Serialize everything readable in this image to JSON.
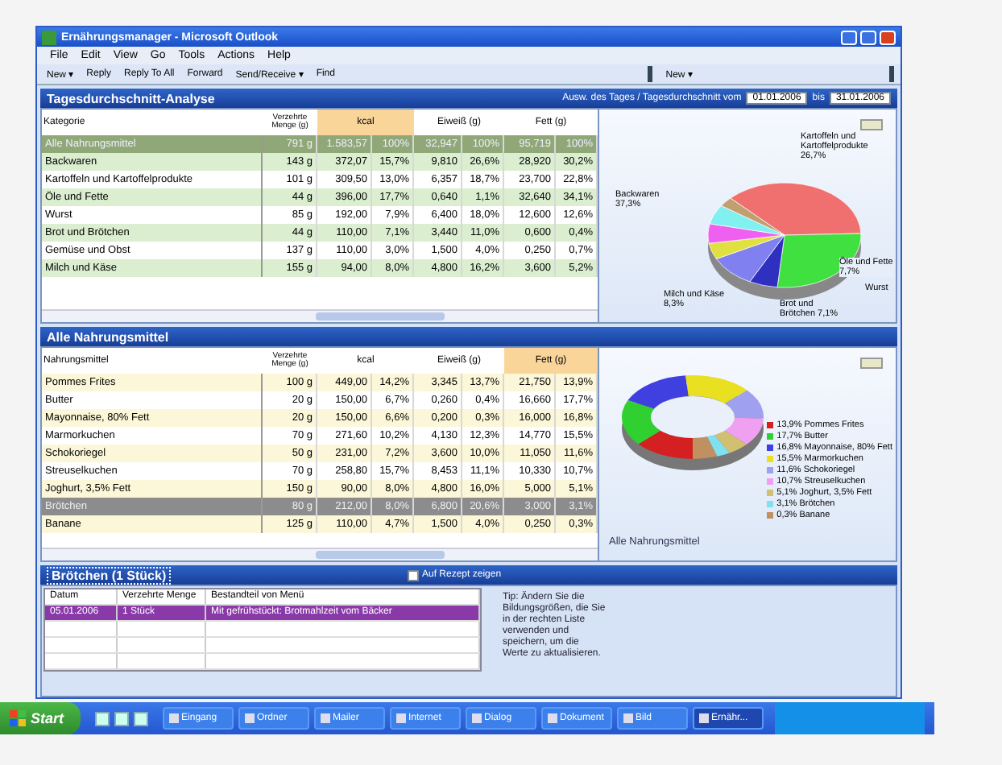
{
  "window": {
    "title": "Ernährungsmanager - Microsoft Outlook"
  },
  "menu": [
    "File",
    "Edit",
    "View",
    "Go",
    "Tools",
    "Actions",
    "Help"
  ],
  "toolbar": {
    "left": [
      "New ▾",
      "Reply",
      "Reply To All",
      "Forward",
      "Send/Receive ▾",
      "Find"
    ],
    "right": [
      "New ▾"
    ]
  },
  "daily": {
    "title": "Tagesdurchschnitt-Analyse",
    "range_label": "Ausw. des Tages / Tagesdurchschnitt vom",
    "from": "01.01.2006",
    "to_label": "bis",
    "to": "31.01.2006",
    "columns": [
      {
        "label": "Kategorie",
        "sorted": false
      },
      {
        "label": "Verzehrte Menge (g)",
        "sorted": false
      },
      {
        "label": "kcal",
        "sorted": true
      },
      {
        "label": "Eiweiß (g)",
        "sorted": false
      },
      {
        "label": "Fett (g)",
        "sorted": false
      }
    ],
    "rows": [
      {
        "kind": "group",
        "cells": [
          "Alle Nahrungsmittel",
          "791 g",
          {
            "value": "1.583,57",
            "share": "100%"
          },
          {
            "value": "32,947",
            "share": "100%"
          },
          {
            "value": "95,719",
            "share": "100%"
          }
        ]
      },
      {
        "kind": "item",
        "cells": [
          "Backwaren",
          "143 g",
          {
            "value": "372,07",
            "share": "15,7%"
          },
          {
            "value": "9,810",
            "share": "26,6%"
          },
          {
            "value": "28,920",
            "share": "30,2%"
          }
        ]
      },
      {
        "kind": "item",
        "cells": [
          "Kartoffeln und Kartoffelprodukte",
          "101 g",
          {
            "value": "309,50",
            "share": "13,0%"
          },
          {
            "value": "6,357",
            "share": "18,7%"
          },
          {
            "value": "23,700",
            "share": "22,8%"
          }
        ]
      },
      {
        "kind": "item",
        "cells": [
          "Öle und Fette",
          "44 g",
          {
            "value": "396,00",
            "share": "17,7%"
          },
          {
            "value": "0,640",
            "share": "1,1%"
          },
          {
            "value": "32,640",
            "share": "34,1%"
          }
        ]
      },
      {
        "kind": "item",
        "cells": [
          "Wurst",
          "85 g",
          {
            "value": "192,00",
            "share": "7,9%"
          },
          {
            "value": "6,400",
            "share": "18,0%"
          },
          {
            "value": "12,600",
            "share": "12,6%"
          }
        ]
      },
      {
        "kind": "item",
        "cells": [
          "Brot und Brötchen",
          "44 g",
          {
            "value": "110,00",
            "share": "7,1%"
          },
          {
            "value": "3,440",
            "share": "11,0%"
          },
          {
            "value": "0,600",
            "share": "0,4%"
          }
        ]
      },
      {
        "kind": "item",
        "cells": [
          "Gemüse und Obst",
          "137 g",
          {
            "value": "110,00",
            "share": "3,0%"
          },
          {
            "value": "1,500",
            "share": "4,0%"
          },
          {
            "value": "0,250",
            "share": "0,7%"
          }
        ]
      },
      {
        "kind": "item",
        "cells": [
          "Milch und Käse",
          "155 g",
          {
            "value": "94,00",
            "share": "8,0%"
          },
          {
            "value": "4,800",
            "share": "16,2%"
          },
          {
            "value": "3,600",
            "share": "5,2%"
          }
        ]
      }
    ],
    "pie_labels": [
      {
        "text": "Kartoffeln und Kartoffelprodukte 26,7%",
        "kind": "top"
      },
      {
        "text": "Backwaren 37,3%",
        "kind": "left"
      },
      {
        "text": "Öle und Fette 7,7%",
        "kind": "right"
      },
      {
        "text": "Milch und Käse 8,3%",
        "kind": "bottomleft"
      },
      {
        "text": "Brot und Brötchen 7,1%",
        "kind": "bottom"
      },
      {
        "text": "Wurst",
        "kind": "bottomright"
      }
    ]
  },
  "foods": {
    "title": "Alle Nahrungsmittel",
    "columns": [
      {
        "label": "Nahrungsmittel",
        "sorted": false
      },
      {
        "label": "Verzehrte Menge (g)",
        "sorted": false
      },
      {
        "label": "kcal",
        "sorted": false
      },
      {
        "label": "Eiweiß (g)",
        "sorted": false
      },
      {
        "label": "Fett (g)",
        "sorted": true
      }
    ],
    "rows": [
      {
        "selected": false,
        "cells": [
          "Pommes Frites",
          "100 g",
          {
            "value": "449,00",
            "share": "14,2%"
          },
          {
            "value": "3,345",
            "share": "13,7%"
          },
          {
            "value": "21,750",
            "share": "13,9%"
          }
        ]
      },
      {
        "selected": false,
        "cells": [
          "Butter",
          "20 g",
          {
            "value": "150,00",
            "share": "6,7%"
          },
          {
            "value": "0,260",
            "share": "0,4%"
          },
          {
            "value": "16,660",
            "share": "17,7%"
          }
        ]
      },
      {
        "selected": false,
        "cells": [
          "Mayonnaise, 80% Fett",
          "20 g",
          {
            "value": "150,00",
            "share": "6,6%"
          },
          {
            "value": "0,200",
            "share": "0,3%"
          },
          {
            "value": "16,000",
            "share": "16,8%"
          }
        ]
      },
      {
        "selected": false,
        "cells": [
          "Marmorkuchen",
          "70 g",
          {
            "value": "271,60",
            "share": "10,2%"
          },
          {
            "value": "4,130",
            "share": "12,3%"
          },
          {
            "value": "14,770",
            "share": "15,5%"
          }
        ]
      },
      {
        "selected": false,
        "cells": [
          "Schokoriegel",
          "50 g",
          {
            "value": "231,00",
            "share": "7,2%"
          },
          {
            "value": "3,600",
            "share": "10,0%"
          },
          {
            "value": "11,050",
            "share": "11,6%"
          }
        ]
      },
      {
        "selected": false,
        "cells": [
          "Streuselkuchen",
          "70 g",
          {
            "value": "258,80",
            "share": "15,7%"
          },
          {
            "value": "8,453",
            "share": "11,1%"
          },
          {
            "value": "10,330",
            "share": "10,7%"
          }
        ]
      },
      {
        "selected": false,
        "cells": [
          "Joghurt, 3,5% Fett",
          "150 g",
          {
            "value": "90,00",
            "share": "8,0%"
          },
          {
            "value": "4,800",
            "share": "16,0%"
          },
          {
            "value": "5,000",
            "share": "5,1%"
          }
        ]
      },
      {
        "selected": true,
        "cells": [
          "Brötchen",
          "80 g",
          {
            "value": "212,00",
            "share": "8,0%"
          },
          {
            "value": "6,800",
            "share": "20,6%"
          },
          {
            "value": "3,000",
            "share": "3,1%"
          }
        ]
      },
      {
        "selected": false,
        "cells": [
          "Banane",
          "125 g",
          {
            "value": "110,00",
            "share": "4,7%"
          },
          {
            "value": "1,500",
            "share": "4,0%"
          },
          {
            "value": "0,250",
            "share": "0,3%"
          }
        ]
      }
    ],
    "legend": [
      {
        "text": "13,9% Pommes Frites",
        "color": "#d42020"
      },
      {
        "text": "17,7% Butter",
        "color": "#30d030"
      },
      {
        "text": "16,8% Mayonnaise, 80% Fett",
        "color": "#4040e0"
      },
      {
        "text": "15,5% Marmorkuchen",
        "color": "#e8e020"
      },
      {
        "text": "11,6% Schokoriegel",
        "color": "#a0a0f0"
      },
      {
        "text": "10,7% Streuselkuchen",
        "color": "#f0a0f0"
      },
      {
        "text": "5,1% Joghurt, 3,5% Fett",
        "color": "#d0c070"
      },
      {
        "text": "3,1% Brötchen",
        "color": "#80e0f0"
      },
      {
        "text": "0,3% Banane",
        "color": "#c09060"
      }
    ],
    "caption": "Alle Nahrungsmittel"
  },
  "detail": {
    "title": "Brötchen (1 Stück)",
    "columns": [
      "Datum",
      "Verzehrte Menge",
      "Bestandteil von Menü"
    ],
    "rows": [
      {
        "selected": true,
        "cells": [
          "05.01.2006",
          "1 Stück",
          "Mit gefrühstückt: Brotmahlzeit vom Bäcker"
        ]
      },
      {
        "selected": false,
        "cells": []
      },
      {
        "selected": false,
        "cells": []
      },
      {
        "selected": false,
        "cells": []
      }
    ],
    "option": {
      "label": "Auf Rezept zeigen",
      "checked": false
    },
    "tip": "Tip: Ändern Sie die Bildungsgrößen, die Sie in der rechten Liste verwenden und speichern, um die Werte zu aktualisieren."
  },
  "taskbar": {
    "start": "Start",
    "tasks": [
      {
        "label": "Eingang",
        "selected": false
      },
      {
        "label": "Ordner",
        "selected": false
      },
      {
        "label": "Mailer",
        "selected": false
      },
      {
        "label": "Internet",
        "selected": false
      },
      {
        "label": "Dialog",
        "selected": false
      },
      {
        "label": "Dokument",
        "selected": false
      },
      {
        "label": "Bild",
        "selected": false
      },
      {
        "label": "Ernähr...",
        "selected": true
      }
    ]
  }
}
